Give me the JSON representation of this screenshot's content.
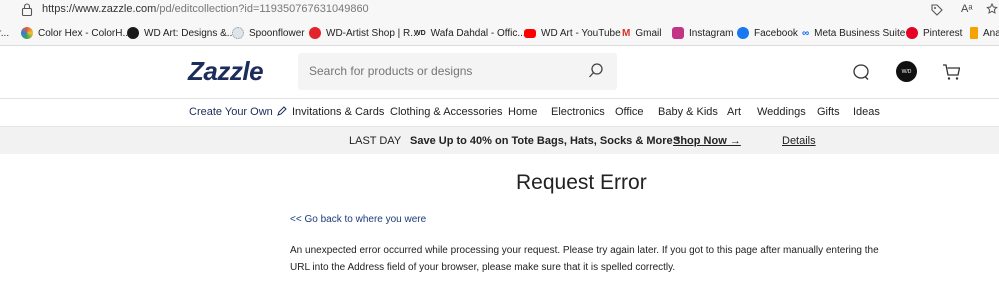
{
  "browser": {
    "url_main": "https://www.zazzle.com",
    "url_path": "/pd/editcollection?id=119350767631049860",
    "read_aloud": "Aᵃ",
    "bookmarks": [
      {
        "label": "r...",
        "color": "#bbbbbb"
      },
      {
        "label": "Color Hex - ColorH...",
        "color": "#e45c3a"
      },
      {
        "label": "WD Art: Designs &...",
        "color": "#1a1a1a"
      },
      {
        "label": "Spoonflower",
        "color": "#9aa7b0"
      },
      {
        "label": "WD-Artist Shop | R...",
        "color": "#e3242b"
      },
      {
        "label": "Wafa Dahdal - Offic...",
        "color": "#222222"
      },
      {
        "label": "WD Art - YouTube",
        "color": "#ff0000"
      },
      {
        "label": "Gmail",
        "color": "#d93025"
      },
      {
        "label": "Instagram",
        "color": "#c13584"
      },
      {
        "label": "Facebook",
        "color": "#1877f2"
      },
      {
        "label": "Meta Business Suite",
        "color": "#0866ff"
      },
      {
        "label": "Pinterest",
        "color": "#e60023"
      },
      {
        "label": "Ana",
        "color": "#f4a300"
      }
    ]
  },
  "header": {
    "logo": "Zazzle",
    "search_placeholder": "Search for products or designs",
    "avatar_text": "W/D"
  },
  "nav": {
    "items": [
      "Create Your Own",
      "Invitations & Cards",
      "Clothing & Accessories",
      "Home",
      "Electronics",
      "Office",
      "Baby & Kids",
      "Art",
      "Weddings",
      "Gifts",
      "Ideas"
    ]
  },
  "promo": {
    "label": "LAST DAY",
    "offer": "Save Up to 40% on Tote Bags, Hats, Socks & More *",
    "shop_now": "Shop Now →",
    "details": "Details"
  },
  "content": {
    "title": "Request Error",
    "back_link": "<< Go back to where you were",
    "message": "An unexpected error occurred while processing your request. Please try again later. If you got to this page after manually entering the URL into the Address field of your browser, please make sure that it is spelled correctly."
  },
  "colors": {
    "brand_navy": "#1c2c5b",
    "link_blue": "#1c3c7a",
    "promo_bg": "#f2f2f2"
  }
}
